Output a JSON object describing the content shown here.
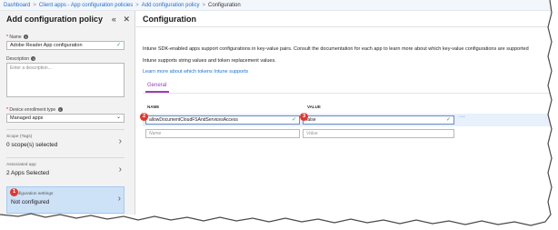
{
  "breadcrumb": {
    "items": [
      "Dashboard",
      "Client apps - App configuration policies",
      "Add configuration policy",
      "Configuration"
    ],
    "separator": ">"
  },
  "left_blade": {
    "title": "Add configuration policy",
    "collapse_glyph": "«",
    "close_glyph": "✕",
    "name": {
      "label": "Name",
      "required_mark": "*",
      "info_icon": "i",
      "value": "Adobe Reader App configuration"
    },
    "description": {
      "label": "Description",
      "info_icon": "i",
      "placeholder": "Enter a description..."
    },
    "enrollment": {
      "label": "Device enrollment type",
      "required_mark": "*",
      "info_icon": "i",
      "value": "Managed apps"
    },
    "nav": [
      {
        "small": "Scope (Tags)",
        "big": "0 scope(s) selected"
      },
      {
        "small": "Associated app",
        "big": "2 Apps Selected"
      },
      {
        "small": "Configuration settings",
        "big": "Not configured"
      }
    ]
  },
  "right_blade": {
    "title": "Configuration",
    "intro": "Intune SDK-enabled apps support configurations in key-value pairs. Consult the documentation for each app to learn more about which key-value configurations are supported",
    "intro2": "Intune supports string values and token replacement values.",
    "link": "Learn more about which tokens Intune supports",
    "tab": "General",
    "col_name": "NAME",
    "col_value": "VALUE",
    "row": {
      "name": "allowDocumentCloudFSAndServicesAccess",
      "value": "false"
    },
    "empty_row": {
      "name_placeholder": "Name",
      "value_placeholder": "Value"
    },
    "more_glyph": "···"
  },
  "badges": [
    "1",
    "2",
    "3"
  ],
  "colors": {
    "accent": "#1f6fd1",
    "badge": "#e5372d",
    "tab": "#9b3dbd",
    "valid": "#3a9b3a"
  }
}
